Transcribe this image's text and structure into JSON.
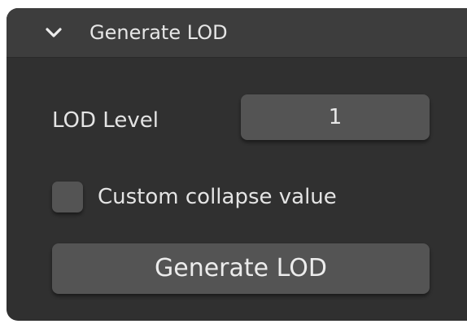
{
  "panel": {
    "title": "Generate LOD",
    "expanded": true,
    "icon": "chevron-down-icon"
  },
  "lod_level": {
    "label": "LOD Level",
    "value": "1"
  },
  "custom_collapse": {
    "label": "Custom collapse value",
    "checked": false
  },
  "generate_button": {
    "label": "Generate LOD"
  },
  "colors": {
    "panel_background": "#303030",
    "header_background": "#3d3d3d",
    "control_background": "#545454",
    "text": "#e4e4e4"
  }
}
